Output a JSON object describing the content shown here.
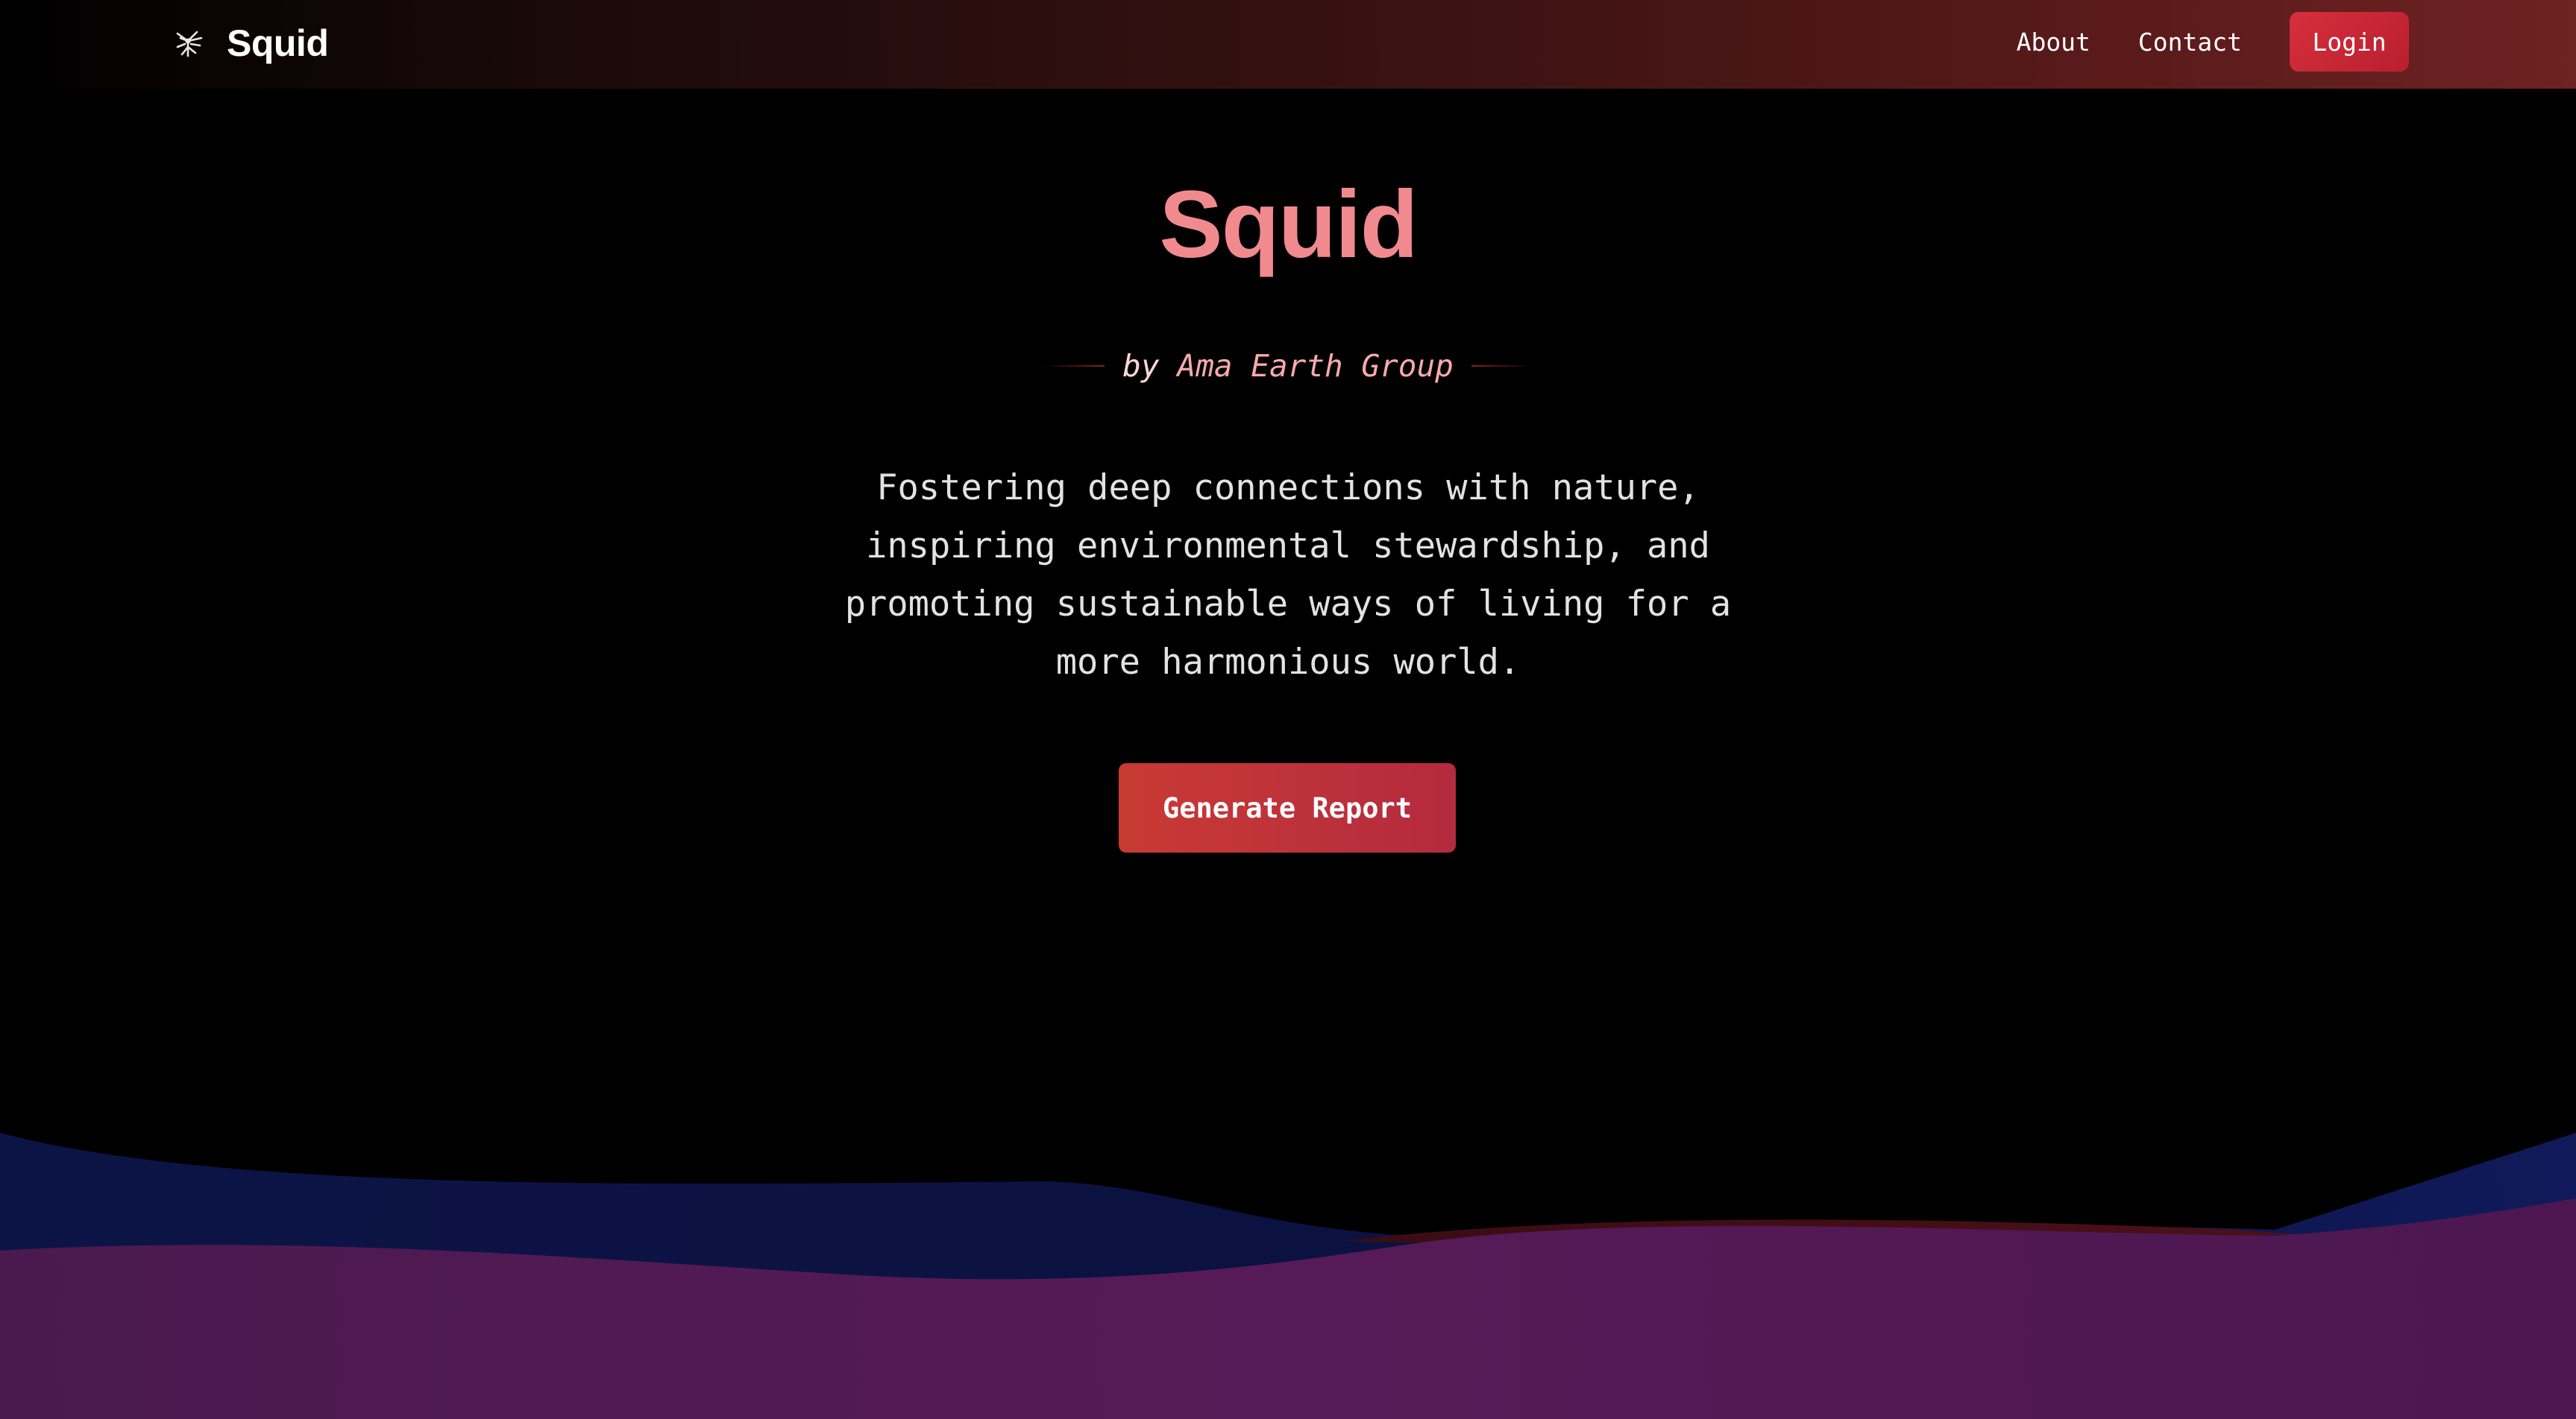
{
  "header": {
    "brand_name": "Squid",
    "brand_icon": "squid-logo-icon",
    "nav": {
      "about_label": "About",
      "contact_label": "Contact",
      "login_label": "Login"
    }
  },
  "hero": {
    "title": "Squid",
    "by_word": "by",
    "org_name": "Ama Earth Group",
    "tagline_lines": [
      "Fostering deep connections with nature,",
      "inspiring environmental stewardship, and",
      "promoting sustainable ways of living for a",
      "more harmonious world."
    ],
    "cta_label": "Generate Report"
  },
  "colors": {
    "background": "#000000",
    "title": "#f08a8f",
    "accent": "#d62f3b",
    "wave_navy": "#0c1445",
    "wave_purple": "#521a52"
  }
}
